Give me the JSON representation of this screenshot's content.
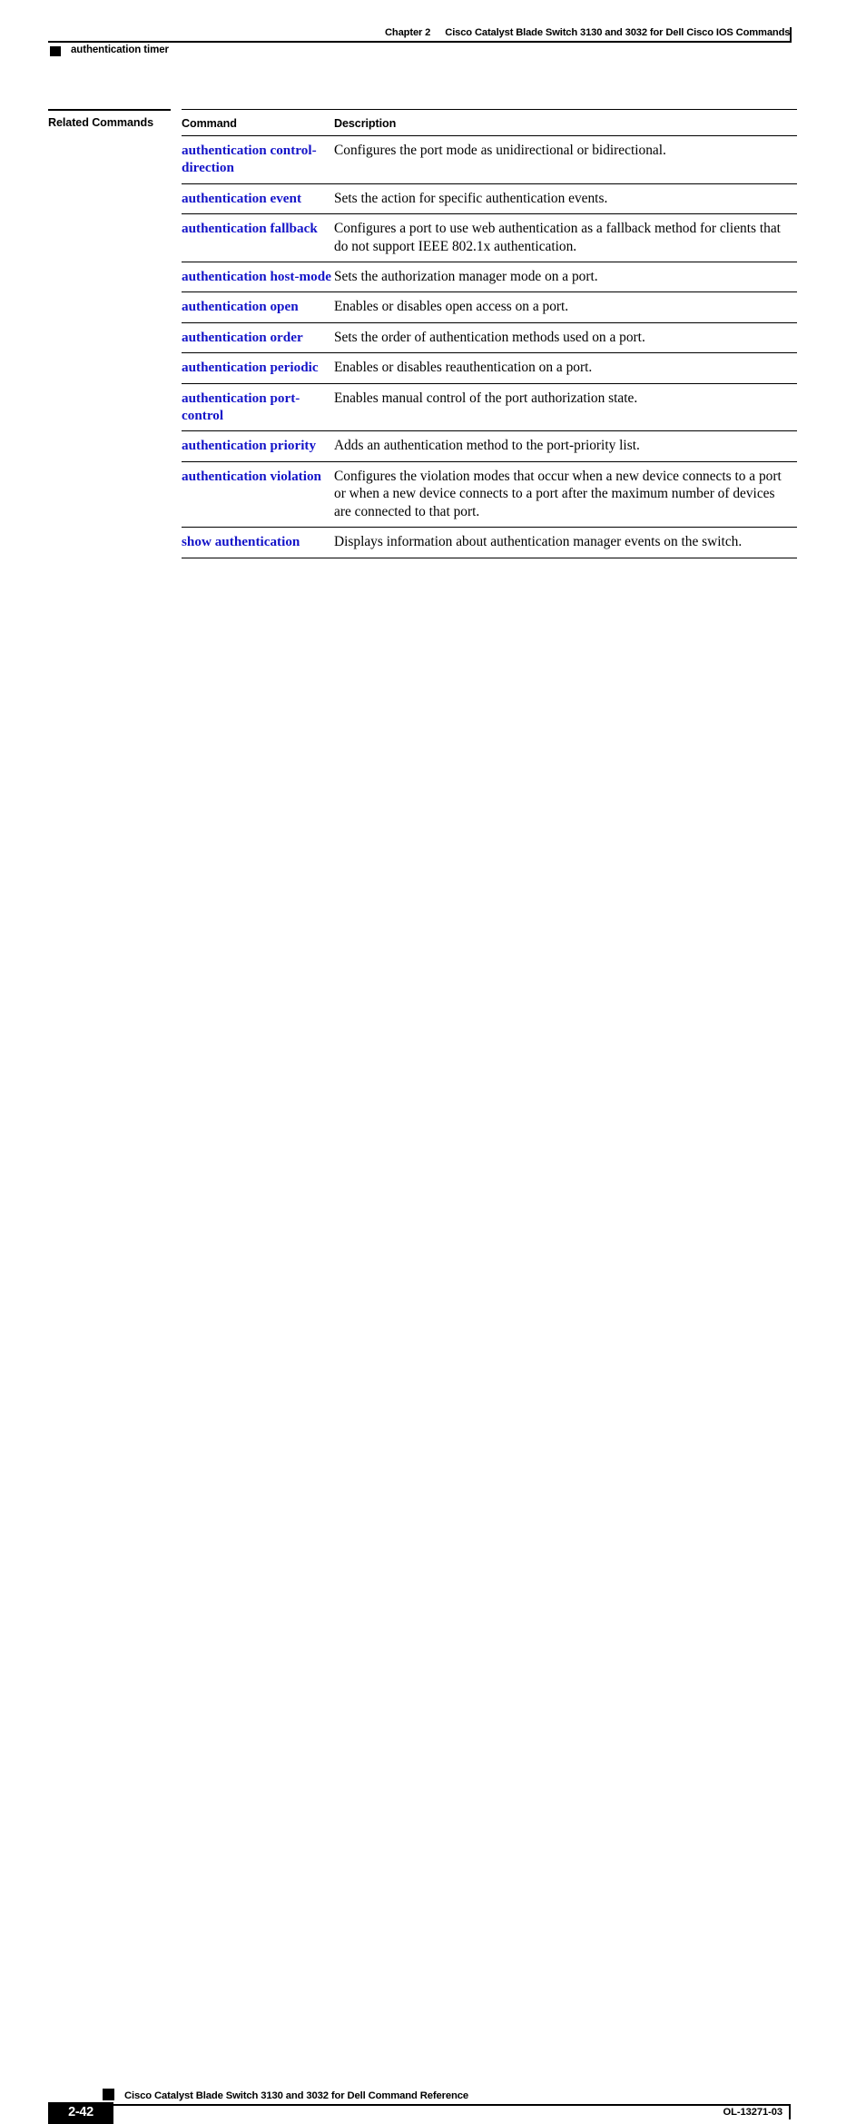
{
  "header": {
    "chapter_label": "Chapter 2",
    "chapter_title": "Cisco Catalyst Blade Switch 3130 and 3032 for Dell Cisco IOS Commands",
    "running_title": "authentication timer"
  },
  "section": {
    "label": "Related Commands"
  },
  "table": {
    "columns": [
      "Command",
      "Description"
    ],
    "rows": [
      {
        "command": "authentication control-direction",
        "description": "Configures the port mode as unidirectional or bidirectional."
      },
      {
        "command": "authentication event",
        "description": "Sets the action for specific authentication events."
      },
      {
        "command": "authentication fallback",
        "description": "Configures a port to use web authentication as a fallback method for clients that do not support IEEE 802.1x authentication."
      },
      {
        "command": "authentication host-mode",
        "description": "Sets the authorization manager mode on a port."
      },
      {
        "command": "authentication open",
        "description": "Enables or disables open access on a port."
      },
      {
        "command": "authentication order",
        "description": "Sets the order of authentication methods used on a port."
      },
      {
        "command": "authentication periodic",
        "description": "Enables or disables reauthentication on a port."
      },
      {
        "command": "authentication port-control",
        "description": "Enables manual control of the port authorization state."
      },
      {
        "command": "authentication priority",
        "description": "Adds an authentication method to the port-priority list."
      },
      {
        "command": "authentication violation",
        "description": "Configures the violation modes that occur when a new device connects to a port or when a new device connects to a port after the maximum number of devices are connected to that port."
      },
      {
        "command": "show authentication",
        "description": "Displays information about authentication manager events on the switch."
      }
    ]
  },
  "footer": {
    "doc_title": "Cisco Catalyst Blade Switch 3130 and 3032 for Dell Command Reference",
    "page_number": "2-42",
    "doc_id": "OL-13271-03"
  },
  "colors": {
    "link_blue": "#1414c8",
    "rule_black": "#000000",
    "page_background": "#ffffff"
  }
}
